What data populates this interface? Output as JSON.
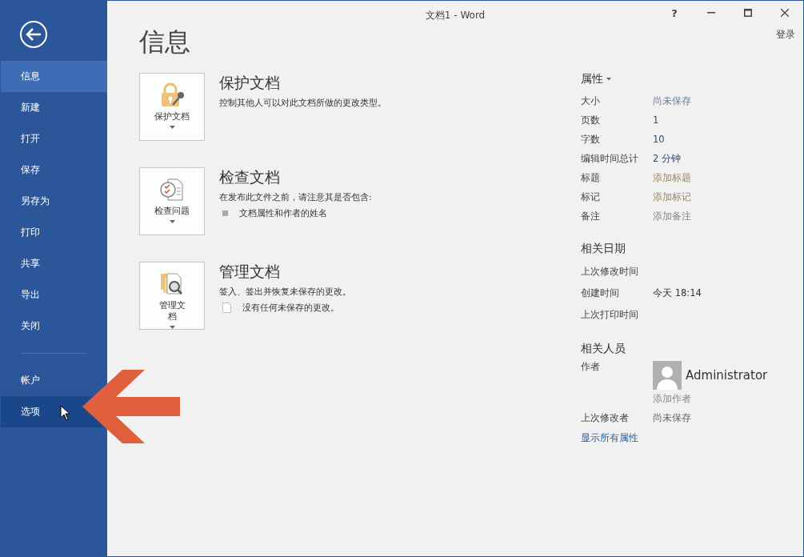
{
  "window": {
    "title": "文档1 - Word",
    "help": "?",
    "sign_in": "登录"
  },
  "sidebar": {
    "items": [
      {
        "label": "信息",
        "selected": true,
        "hovered": false
      },
      {
        "label": "新建",
        "selected": false,
        "hovered": false
      },
      {
        "label": "打开",
        "selected": false,
        "hovered": false
      },
      {
        "label": "保存",
        "selected": false,
        "hovered": false
      },
      {
        "label": "另存为",
        "selected": false,
        "hovered": false
      },
      {
        "label": "打印",
        "selected": false,
        "hovered": false
      },
      {
        "label": "共享",
        "selected": false,
        "hovered": false
      },
      {
        "label": "导出",
        "selected": false,
        "hovered": false
      },
      {
        "label": "关闭",
        "selected": false,
        "hovered": false
      }
    ],
    "bottom_items": [
      {
        "label": "帐户",
        "selected": false,
        "hovered": false
      },
      {
        "label": "选项",
        "selected": false,
        "hovered": true
      }
    ]
  },
  "page_title": "信息",
  "sections": [
    {
      "kind": "protect",
      "button_label": "保护文档",
      "title": "保护文档",
      "description": "控制其他人可以对此文档所做的更改类型。"
    },
    {
      "kind": "inspect",
      "button_label": "检查问题",
      "title": "检查文档",
      "description": "在发布此文件之前，请注意其是否包含:",
      "bullet": "文档属性和作者的姓名"
    },
    {
      "kind": "manage",
      "button_label": "管理文档",
      "title": "管理文档",
      "description": "签入、签出并恢复未保存的更改。",
      "note": "没有任何未保存的更改。"
    }
  ],
  "properties": {
    "heading": "属性",
    "rows": [
      {
        "label": "大小",
        "value": "尚未保存",
        "kind": "muted"
      },
      {
        "label": "页数",
        "value": "1",
        "kind": "plain"
      },
      {
        "label": "字数",
        "value": "10",
        "kind": "plain"
      },
      {
        "label": "编辑时间总计",
        "value": "2 分钟",
        "kind": "plain"
      },
      {
        "label": "标题",
        "value": "添加标题",
        "kind": "editable"
      },
      {
        "label": "标记",
        "value": "添加标记",
        "kind": "editable"
      },
      {
        "label": "备注",
        "value": "添加备注",
        "kind": "placeholder"
      }
    ]
  },
  "dates": {
    "heading": "相关日期",
    "rows": [
      {
        "label": "上次修改时间"
      },
      {
        "label": "创建时间",
        "value": "今天 18:14"
      },
      {
        "label": "上次打印时间"
      }
    ]
  },
  "people": {
    "heading": "相关人员",
    "author_label": "作者",
    "author_name": "Administrator",
    "add_author": "添加作者",
    "last_modified_by_label": "上次修改者",
    "last_modified_by": "尚未保存",
    "show_all": "显示所有属性"
  }
}
